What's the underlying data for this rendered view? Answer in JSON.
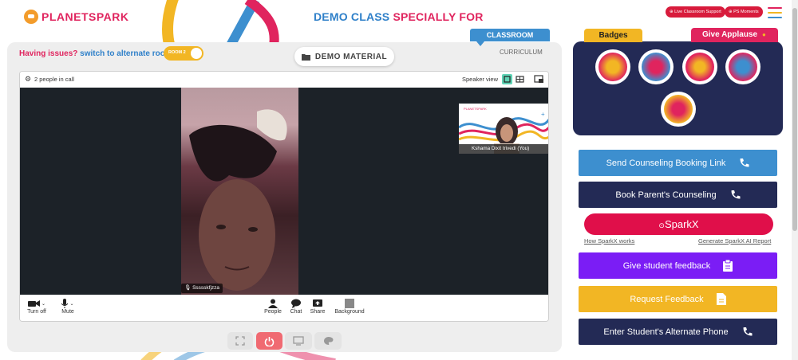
{
  "header": {
    "logo_text": "PLANETSPARK",
    "title_part1": "DEMO CLASS ",
    "title_part2": "SPECIALLY FOR",
    "live_support_label": "Live Classroom Support",
    "ps_moments_label": "PS Moments"
  },
  "left": {
    "issues_question": "Having issues?",
    "issues_link": "switch to alternate room",
    "room_toggle": "ROOM 2",
    "demo_material": "DEMO MATERIAL",
    "classroom_tab": "CLASSROOM",
    "curriculum": "CURRICULUM"
  },
  "call": {
    "people_count": "2 people in call",
    "speaker_view": "Speaker view",
    "main_participant": "Ssssskfjzza",
    "self_participant": "Kshama Dixit trivedi (You)",
    "controls": {
      "turn_off": "Turn off",
      "mute": "Mute",
      "people": "People",
      "chat": "Chat",
      "share": "Share",
      "background": "Background"
    }
  },
  "right": {
    "badges_tab": "Badges",
    "applause_tab": "Give Applause",
    "actions": {
      "counseling_link": "Send Counseling Booking Link",
      "parents_counseling": "Book Parent's Counseling",
      "sparkx": "SparkX",
      "how_sparkx": "How SparkX works",
      "generate_report": "Generate SparkX AI Report",
      "student_feedback": "Give student feedback",
      "request_feedback": "Request Feedback",
      "alt_phone": "Enter Student's Alternate Phone"
    }
  },
  "colors": {
    "brand_pink": "#e0245e",
    "brand_blue": "#2f80c9",
    "navy": "#232a55",
    "purple": "#7b1df5",
    "amber": "#f2b624",
    "leave_red": "#f06a72"
  }
}
